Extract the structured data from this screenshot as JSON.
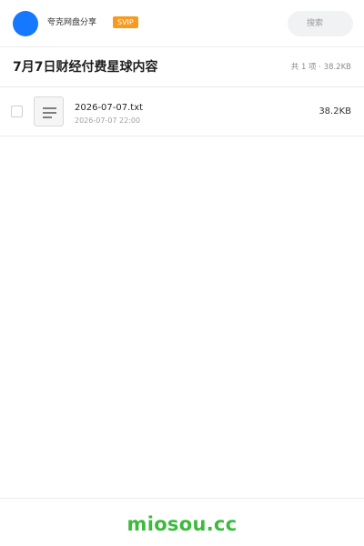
{
  "header": {
    "user_name": "夸克网盘分享",
    "badge": "SVIP",
    "search_placeholder": "搜索"
  },
  "share": {
    "title": "7月7日财经付费星球内容",
    "summary": "共 1 项 · 38.2KB"
  },
  "files": [
    {
      "name": "2026-07-07.txt",
      "date": "2026-07-07 22:00",
      "size": "38.2KB",
      "icon": "text-file-icon"
    }
  ],
  "footer": {
    "brand": "miosou.cc"
  },
  "colors": {
    "avatar": "#1677ff",
    "badge": "#f59b22",
    "brand": "#3cba3c"
  }
}
